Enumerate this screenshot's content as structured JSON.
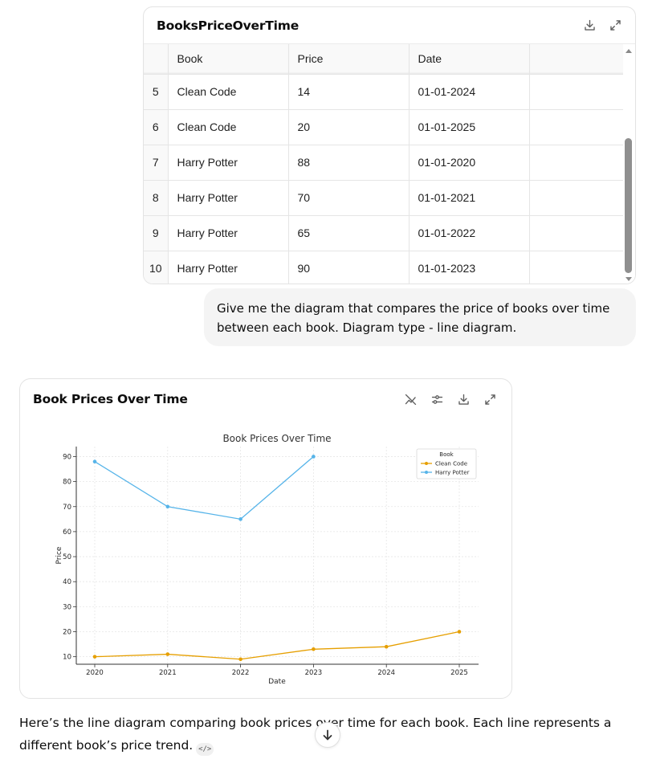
{
  "table_card": {
    "title": "BooksPriceOverTime",
    "icons": [
      "download-icon",
      "expand-icon"
    ],
    "columns": [
      "",
      "Book",
      "Price",
      "Date",
      ""
    ],
    "rows": [
      {
        "idx": "5",
        "book": "Clean Code",
        "price": "14",
        "date": "01-01-2024"
      },
      {
        "idx": "6",
        "book": "Clean Code",
        "price": "20",
        "date": "01-01-2025"
      },
      {
        "idx": "7",
        "book": "Harry Potter",
        "price": "88",
        "date": "01-01-2020"
      },
      {
        "idx": "8",
        "book": "Harry Potter",
        "price": "70",
        "date": "01-01-2021"
      },
      {
        "idx": "9",
        "book": "Harry Potter",
        "price": "65",
        "date": "01-01-2022"
      },
      {
        "idx": "10",
        "book": "Harry Potter",
        "price": "90",
        "date": "01-01-2023"
      }
    ]
  },
  "user_message": "Give me the diagram that compares the price of books over time between each book. Diagram type - line diagram.",
  "chart_card": {
    "title": "Book Prices Over Time",
    "icons": [
      "static-chart-icon",
      "chart-settings-icon",
      "download-icon",
      "expand-icon"
    ]
  },
  "chart_data": {
    "type": "line",
    "title": "Book Prices Over Time",
    "xlabel": "Date",
    "ylabel": "Price",
    "x": [
      "2020",
      "2021",
      "2022",
      "2023",
      "2024",
      "2025"
    ],
    "ylim": [
      7,
      94
    ],
    "yticks": [
      10,
      20,
      30,
      40,
      50,
      60,
      70,
      80,
      90
    ],
    "grid": true,
    "legend": {
      "title": "Book",
      "placement": "top-right"
    },
    "series": [
      {
        "name": "Clean Code",
        "color": "#e69f00",
        "values": [
          10,
          11,
          9,
          13,
          14,
          20
        ]
      },
      {
        "name": "Harry Potter",
        "color": "#56b4e9",
        "values": [
          88,
          70,
          65,
          90,
          null,
          null
        ]
      }
    ]
  },
  "assistant_message": "Here’s the line diagram comparing book prices over time for each book. Each line represents a different book’s price trend.",
  "code_chip": "</>",
  "colors": {
    "card_border": "#e3e3e3",
    "bubble_bg": "#f4f4f4",
    "text": "#0d0d0d"
  }
}
